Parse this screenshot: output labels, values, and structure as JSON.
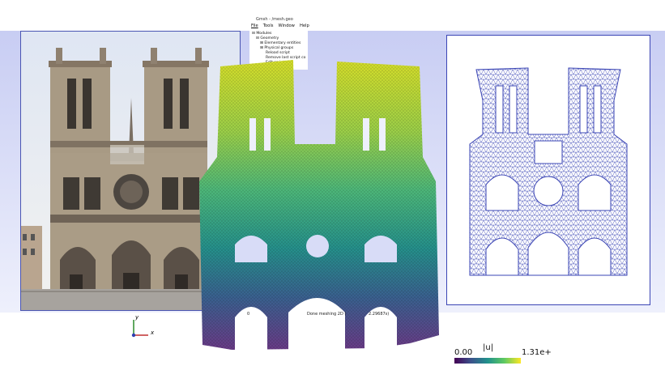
{
  "window": {
    "title": "Gmsh - /mesh.geo",
    "menu": [
      "File",
      "Tools",
      "Window",
      "Help"
    ]
  },
  "tree": {
    "items": [
      {
        "label": "Modules",
        "prefix": "⊟"
      },
      {
        "label": "Geometry",
        "prefix": "⊟"
      },
      {
        "label": "Elementary entities",
        "prefix": "⊞"
      },
      {
        "label": "Physical groups",
        "prefix": "⊞"
      },
      {
        "label": "Reload script",
        "prefix": ""
      },
      {
        "label": "Remove last script co",
        "prefix": ""
      },
      {
        "label": "Edit script",
        "prefix": ""
      }
    ]
  },
  "status": {
    "left": "0",
    "message": "Done meshing 2D (",
    "time": "2.29687s)"
  },
  "axes": {
    "y": "y",
    "x": "x"
  },
  "colorbar": {
    "min": "0.00",
    "label": "|u|",
    "max": "1.31e+",
    "colors": [
      "#440154",
      "#3b528b",
      "#21918c",
      "#5ec962",
      "#fde725"
    ]
  },
  "colors": {
    "panel_border": "#3b45b5",
    "background_band": "#c8cdf3"
  }
}
